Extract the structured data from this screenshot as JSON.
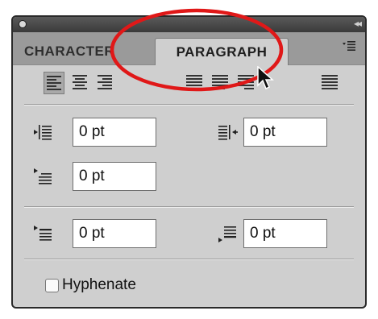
{
  "panel": {
    "tabs": [
      {
        "label": "CHARACTER",
        "active": false
      },
      {
        "label": "PARAGRAPH",
        "active": true
      }
    ],
    "collapse_icon": "double-chevron-left-icon",
    "menu_icon": "panel-menu-icon"
  },
  "alignment": {
    "buttons": [
      {
        "name": "align-left",
        "active": true
      },
      {
        "name": "align-center",
        "active": false
      },
      {
        "name": "align-right",
        "active": false
      },
      {
        "name": "justify-last-left",
        "active": false
      },
      {
        "name": "justify-last-center",
        "active": false
      },
      {
        "name": "justify-last-right",
        "active": false
      },
      {
        "name": "justify-all",
        "active": false
      }
    ]
  },
  "indent": {
    "left_indent": "0 pt",
    "right_indent": "0 pt",
    "first_line_indent": "0 pt"
  },
  "spacing": {
    "space_before": "0 pt",
    "space_after": "0 pt"
  },
  "hyphenate": {
    "label": "Hyphenate",
    "checked": false
  },
  "colors": {
    "annotation_ellipse": "#e01818",
    "panel_bg": "#cfcfcf",
    "titlebar": "#4a4a4a"
  }
}
